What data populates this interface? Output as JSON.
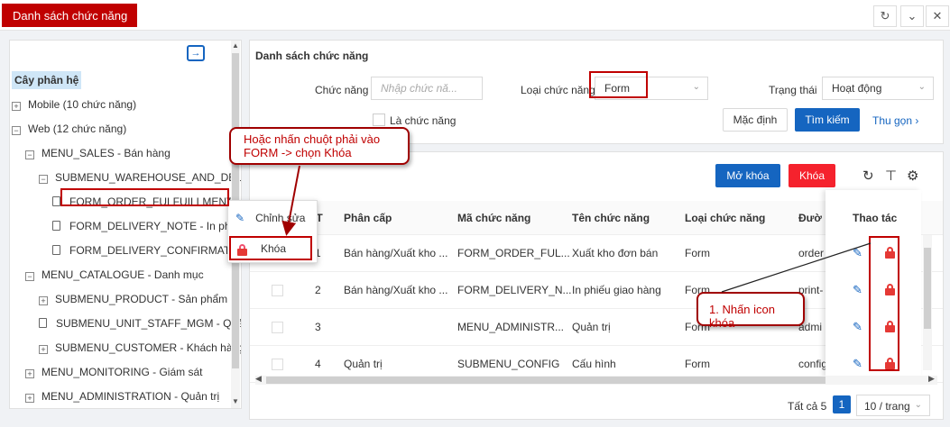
{
  "header": {
    "title": "Danh sách chức năng",
    "refresh_icon": "refresh-icon",
    "dropdown_icon": "chevron-down-icon",
    "close_icon": "close-icon"
  },
  "tree": {
    "header": "Cây phân hệ",
    "nodes": [
      {
        "label": "Mobile (10 chức năng)",
        "expander": "+"
      },
      {
        "label": "Web (12 chức năng)",
        "expander": "−"
      },
      {
        "label": "MENU_SALES - Bán hàng",
        "expander": "−"
      },
      {
        "label": "SUBMENU_WAREHOUSE_AND_DELIV",
        "expander": "−"
      },
      {
        "label": "FORM_ORDER_FULFUILLMENT - Y"
      },
      {
        "label": "FORM_DELIVERY_NOTE - In phiế"
      },
      {
        "label": "FORM_DELIVERY_CONFIRMATIC"
      },
      {
        "label": "MENU_CATALOGUE - Danh mục",
        "expander": "−"
      },
      {
        "label": "SUBMENU_PRODUCT - Sản phẩm",
        "expander": "+"
      },
      {
        "label": "SUBMENU_UNIT_STAFF_MGM - Quả"
      },
      {
        "label": "SUBMENU_CUSTOMER - Khách hàng",
        "expander": "+"
      },
      {
        "label": "MENU_MONITORING - Giám sát",
        "expander": "+"
      },
      {
        "label": "MENU_ADMINISTRATION - Quản trị",
        "expander": "+"
      }
    ]
  },
  "context_menu": {
    "edit": "Chỉnh sửa",
    "lock": "Khóa"
  },
  "filter": {
    "title": "Danh sách chức năng",
    "function_label": "Chức năng",
    "function_placeholder": "Nhập chức nă...",
    "type_label": "Loại chức năng",
    "type_value": "Form",
    "status_label": "Trạng thái",
    "status_value": "Hoạt động",
    "is_function_label": "Là chức năng",
    "default_button": "Mặc định",
    "search_button": "Tìm kiếm",
    "collapse_link": "Thu gọn"
  },
  "table": {
    "unlock_button": "Mở khóa",
    "lock_button": "Khóa",
    "headers": [
      "TT",
      "Phân cấp",
      "Mã chức năng",
      "Tên chức năng",
      "Loại chức năng",
      "Đườ",
      "Thao tác"
    ],
    "rows": [
      {
        "tt": "1",
        "level": "Bán hàng/Xuất kho ...",
        "code": "FORM_ORDER_FUL...",
        "name": "Xuất kho đơn bán",
        "type": "Form",
        "path": "order"
      },
      {
        "tt": "2",
        "level": "Bán hàng/Xuất kho ...",
        "code": "FORM_DELIVERY_N...",
        "name": "In phiếu giao hàng",
        "type": "Form",
        "path": "print-"
      },
      {
        "tt": "3",
        "level": "",
        "code": "MENU_ADMINISTR...",
        "name": "Quản trị",
        "type": "Form",
        "path": "admi"
      },
      {
        "tt": "4",
        "level": "Quản trị",
        "code": "SUBMENU_CONFIG",
        "name": "Cấu hình",
        "type": "Form",
        "path": "config"
      }
    ]
  },
  "pagination": {
    "total": "Tất cả 5",
    "page": "1",
    "page_size": "10 / trang"
  },
  "annotations": {
    "callout_right_click": "Hoặc nhấn chuột phải vào FORM -> chọn Khóa",
    "callout_lock_icon": "1. Nhấn icon khóa"
  },
  "colors": {
    "brand_red": "#c00000",
    "primary_blue": "#1565c0",
    "danger_red": "#f5222d"
  }
}
